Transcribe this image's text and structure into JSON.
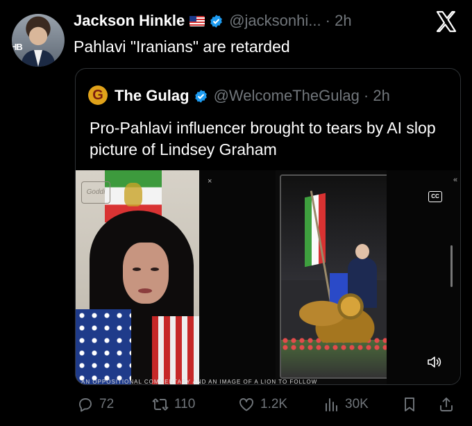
{
  "tweet": {
    "author_name": "Jackson Hinkle",
    "handle": "@jacksonhi... · 2h",
    "text": "Pahlavi \"Iranians\" are retarded"
  },
  "quote": {
    "author_name": "The Gulag",
    "avatar_letter": "G",
    "handle": "@WelcomeTheGulag · 2h",
    "text": "Pro-Pahlavi influencer brought to tears by AI slop picture of Lindsey Graham",
    "video": {
      "cc_label": "CC",
      "watermark": "Goddi",
      "caption": "AN OPPOSITIONAL COMMENTARY AND AN IMAGE OF A LION TO FOLLOW"
    }
  },
  "actions": {
    "replies": "72",
    "reposts": "110",
    "likes": "1.2K",
    "views": "30K"
  },
  "colors": {
    "background": "#000000",
    "text": "#e7e9ea",
    "muted": "#71767b",
    "verified": "#1d9bf0",
    "border": "#2f3336"
  },
  "icons": [
    "verified-icon",
    "us-flag-icon",
    "close-x-icon",
    "reply-icon",
    "repost-icon",
    "like-icon",
    "views-icon",
    "bookmark-icon",
    "share-icon",
    "cc-icon",
    "sound-icon"
  ]
}
